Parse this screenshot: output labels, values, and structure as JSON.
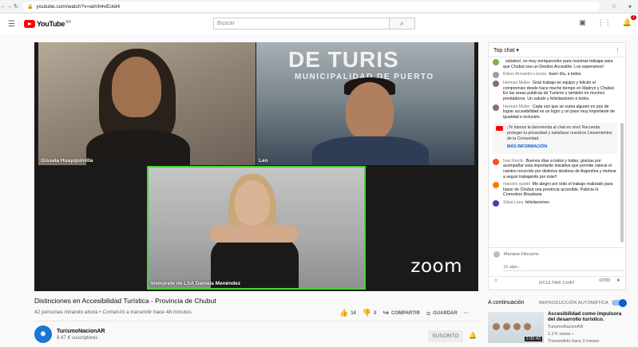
{
  "browser": {
    "url": "youtube.com/watch?v=aimh4vEotd4"
  },
  "header": {
    "brand": "YouTube",
    "region": "AR",
    "search_placeholder": "Buscar",
    "notifications_count": "1"
  },
  "video": {
    "participants": [
      {
        "name": "Gissela Huayquimilla"
      },
      {
        "name": "Leo"
      },
      {
        "name": "Intérprete de LSA Daniela Menéndez"
      }
    ],
    "background_sign": "DE TURIS",
    "background_sign_sub": "MUNICIPALIDAD DE PUERTO",
    "zoom_logo": "zoom",
    "title": "Distinciones en Accesibilidad Turística - Provincia de Chubut",
    "meta": "42 personas mirando ahora • Comenzó a transmitir hace 48 minutos",
    "likes": "14",
    "dislikes": "0",
    "share_label": "COMPARTIR",
    "save_label": "GUARDAR"
  },
  "channel": {
    "name": "TurismoNacionAR",
    "subscribers": "9.47 K suscriptores",
    "subscribe_label": "SUSCRITO"
  },
  "chat": {
    "mode": "Top chat",
    "messages": [
      {
        "author": "",
        "text": "saludos!, es muy enriquecedor para nosotras trabajar para que Chubut sea un Destino Accesible. Los esperamos!",
        "color": "#7cb342"
      },
      {
        "author": "Eliseo Armando Lozzao",
        "text": "buen día, a todos",
        "color": "#9e9e9e"
      },
      {
        "author": "Herman Muller",
        "text": "Gran trabajo en equipo y felicito el compromiso desde hace mucho tiempo en Madryn y Chubut. En las areas publicas de Turismo y también en muchos prestadores. Un saludo y felicitaciones a todos.",
        "color": "#8d6e63"
      },
      {
        "author": "Herman Muller",
        "text": "Cada vez que se suma alguien en pos de lograr accesibilidad es un logro y un paso muy importante de igualdad e inclusión.",
        "color": "#8d6e63"
      }
    ],
    "system_message": "¡Te damos la bienvenida al chat en vivo! Recuerda proteger tu privacidad y satisfacer nuestros Lineamientos de la Comunidad.",
    "system_more": "MÁS INFORMACIÓN",
    "messages_after": [
      {
        "author": "Ivan Revilo",
        "text": "Buenos días a todos y todas, gracias por acompañar esta importante iniciativa que permite valorar el camino recorrido por distintos destinos de Argentina y motivar a seguir trabajando por más!!",
        "color": "#f4511e"
      },
      {
        "author": "marcelo quidel",
        "text": "Me alegro por todo el trabajo realizado para hacer de Chubut una provincia accesible. Patricia H. Comodoro Rivadavia",
        "color": "#f57c00"
      },
      {
        "author": "Silvia Loza",
        "text": "felicitaciones",
        "color": "#5e35b1"
      }
    ],
    "current_user": "Mariana Filocamo",
    "input_placeholder": "Di algo...",
    "char_count": "0/200",
    "hide_label": "OCULTAR CHAT"
  },
  "up_next": {
    "heading": "A continuación",
    "autoplay_label": "REPRODUCCIÓN AUTOMÁTICA",
    "title": "Accesibilidad como impulsora del desarrollo turístico.",
    "channel": "TurismoNacionAR",
    "views": "1.2 K vistas •",
    "when": "Transmitido hace 2 meses",
    "duration": "2:00:43"
  }
}
